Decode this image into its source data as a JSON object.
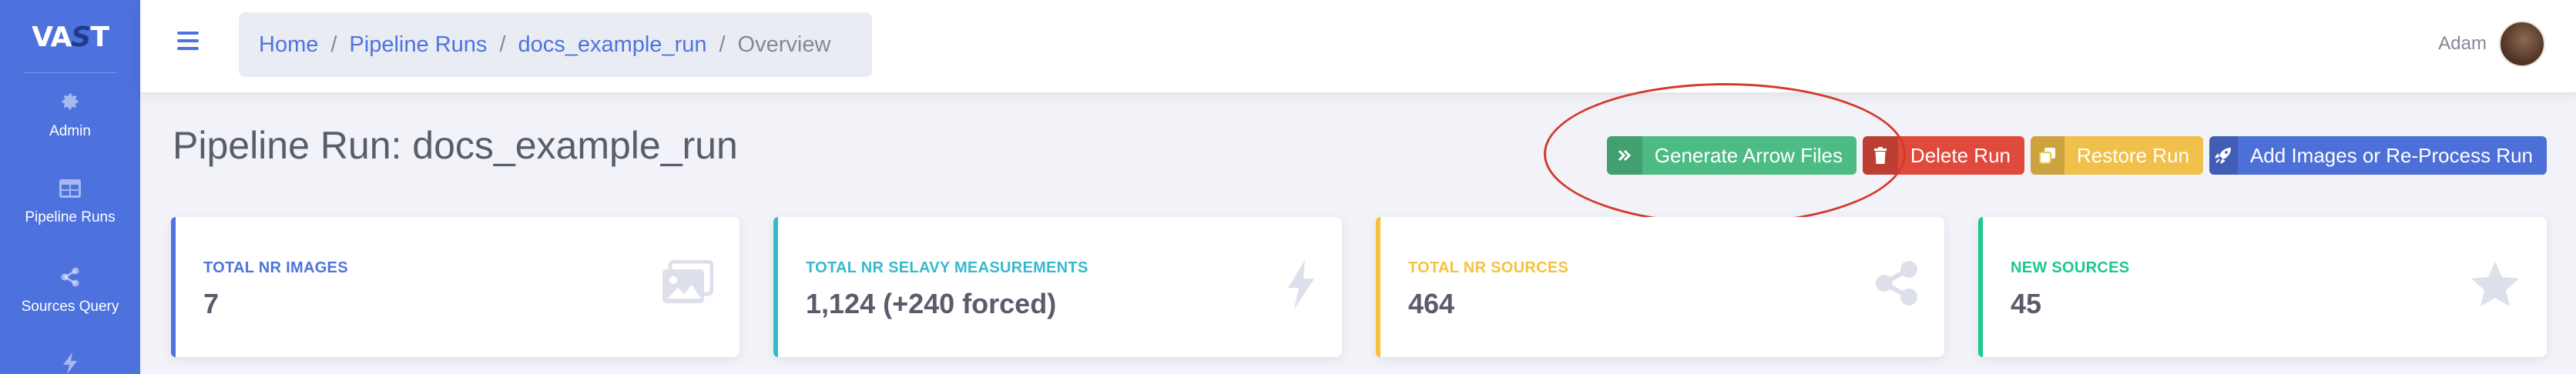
{
  "sidebar": {
    "brand": {
      "part1": "VA",
      "part2": "S",
      "part3": "T"
    },
    "items": [
      {
        "label": "Admin",
        "icon": "gear-icon"
      },
      {
        "label": "Pipeline Runs",
        "icon": "table-icon"
      },
      {
        "label": "Sources Query",
        "icon": "share-icon"
      },
      {
        "label": "",
        "icon": "bolt-icon"
      }
    ]
  },
  "topbar": {
    "breadcrumb": [
      "Home",
      "Pipeline Runs",
      "docs_example_run",
      "Overview"
    ],
    "user_name": "Adam"
  },
  "main": {
    "title": "Pipeline Run: docs_example_run",
    "buttons": {
      "generate": "Generate Arrow Files",
      "delete": "Delete Run",
      "restore": "Restore Run",
      "add_images": "Add Images or Re-Process Run"
    },
    "cards": [
      {
        "caption": "Total Nr Images",
        "value": "7",
        "icon": "images-icon",
        "color": "#4e73df"
      },
      {
        "caption": "Total Nr Selavy Measurements",
        "value": "1,124 (+240 forced)",
        "icon": "bolt-icon",
        "color": "#36b9cc"
      },
      {
        "caption": "Total Nr Sources",
        "value": "464",
        "icon": "share-icon",
        "color": "#f6c23e"
      },
      {
        "caption": "New Sources",
        "value": "45",
        "icon": "star-icon",
        "color": "#1cc88a"
      }
    ]
  },
  "colors": {
    "sidebar": "#4d72de",
    "highlight": "#d43a2c"
  }
}
